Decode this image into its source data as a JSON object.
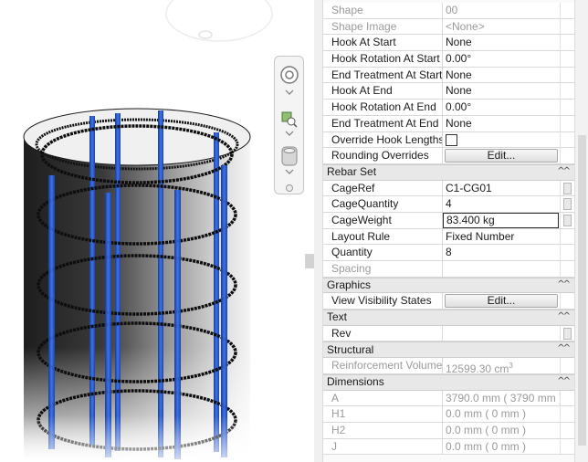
{
  "viewport": {
    "nav_bar": {
      "items": [
        {
          "icon": "steering-wheel-icon"
        },
        {
          "icon": "zoom-icon"
        },
        {
          "icon": "view-cube-icon"
        }
      ]
    }
  },
  "properties": {
    "rows_top": [
      {
        "label": "Shape",
        "value": "00",
        "type": "text",
        "readonly": true
      },
      {
        "label": "Shape Image",
        "value": "<None>",
        "type": "text",
        "readonly": true
      },
      {
        "label": "Hook At Start",
        "value": "None",
        "type": "text"
      },
      {
        "label": "Hook Rotation At Start",
        "value": "0.00°",
        "type": "text"
      },
      {
        "label": "End Treatment At Start",
        "value": "None",
        "type": "text"
      },
      {
        "label": "Hook At End",
        "value": "None",
        "type": "text"
      },
      {
        "label": "Hook Rotation At End",
        "value": "0.00°",
        "type": "text"
      },
      {
        "label": "End Treatment At End",
        "value": "None",
        "type": "text"
      },
      {
        "label": "Override Hook Lengths",
        "value": "",
        "type": "checkbox",
        "checked": false
      },
      {
        "label": "Rounding Overrides",
        "value": "Edit...",
        "type": "button"
      }
    ],
    "sections": [
      {
        "title": "Rebar Set",
        "rows": [
          {
            "label": "CageRef",
            "value": "C1-CG01",
            "type": "text",
            "side": true
          },
          {
            "label": "CageQuantity",
            "value": "4",
            "type": "text",
            "side": true
          },
          {
            "label": "CageWeight",
            "value": "83.400 kg",
            "type": "input",
            "side": true
          },
          {
            "label": "Layout Rule",
            "value": "Fixed Number",
            "type": "text"
          },
          {
            "label": "Quantity",
            "value": "8",
            "type": "text"
          },
          {
            "label": "Spacing",
            "value": "",
            "type": "text",
            "readonly": true
          }
        ]
      },
      {
        "title": "Graphics",
        "rows": [
          {
            "label": "View Visibility States",
            "value": "Edit...",
            "type": "button"
          }
        ]
      },
      {
        "title": "Text",
        "rows": [
          {
            "label": "Rev",
            "value": "",
            "type": "text",
            "side": true
          }
        ]
      },
      {
        "title": "Structural",
        "rows": [
          {
            "label": "Reinforcement Volume",
            "value": "12599.30 cm",
            "unit_sup": "3",
            "type": "text",
            "readonly": true
          }
        ]
      },
      {
        "title": "Dimensions",
        "rows": [
          {
            "label": "A",
            "value": "3790.0 mm ( 3790 mm )",
            "type": "text",
            "readonly": true
          },
          {
            "label": "H1",
            "value": "0.0 mm ( 0 mm )",
            "type": "text",
            "readonly": true
          },
          {
            "label": "H2",
            "value": "0.0 mm ( 0 mm )",
            "type": "text",
            "readonly": true
          },
          {
            "label": "J",
            "value": "0.0 mm ( 0 mm )",
            "type": "text",
            "readonly": true
          }
        ]
      }
    ],
    "section_toggle_glyph": "^^",
    "colors": {
      "rebar_blue": "#2f5fd0",
      "section_bg": "#e8e8e8",
      "readonly_text": "#9a9a9a"
    }
  }
}
